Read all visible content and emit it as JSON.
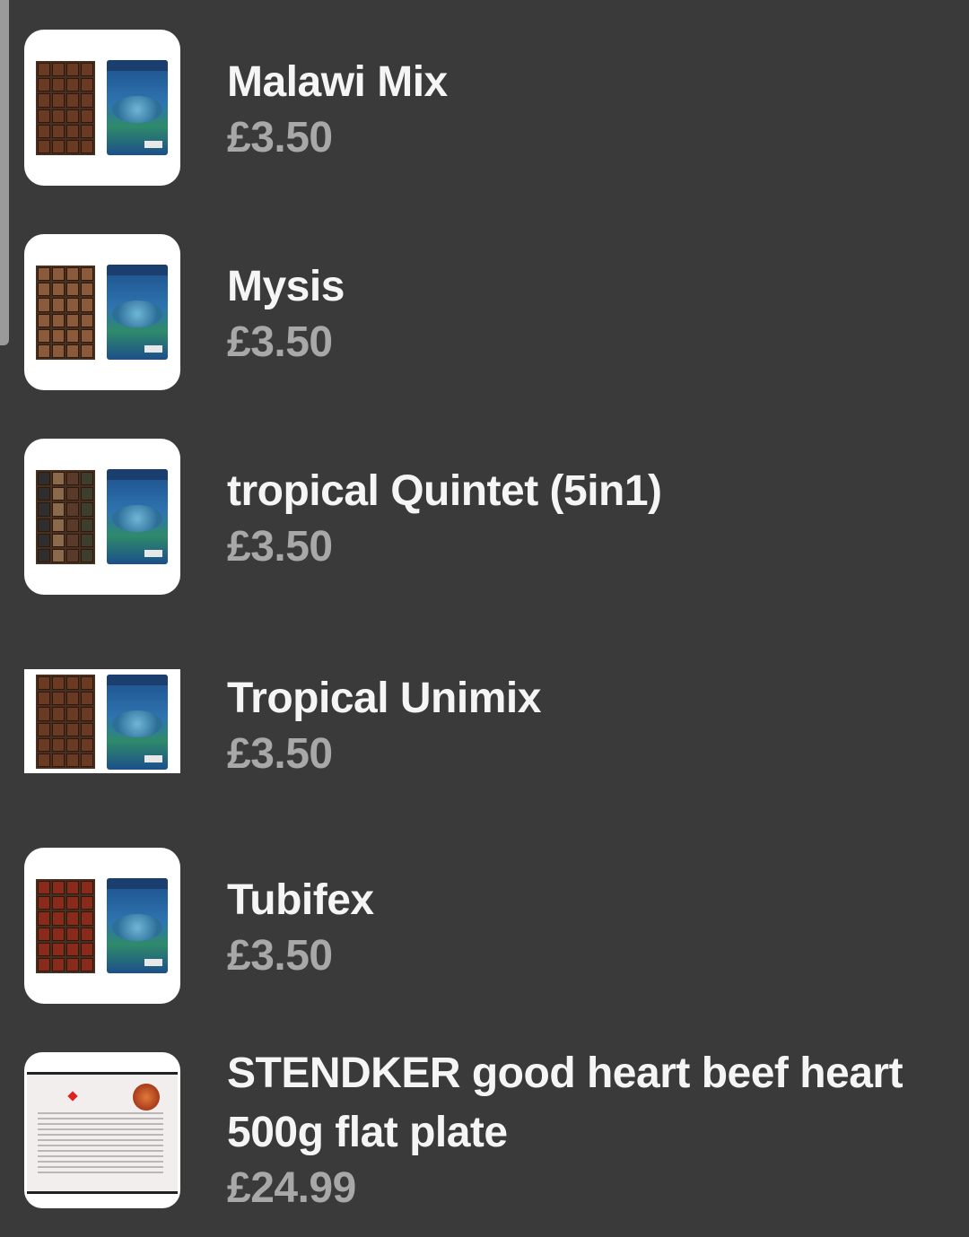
{
  "products": [
    {
      "name": "Malawi Mix",
      "price": "£3.50",
      "image_icon": "malawi-mix-pack-image"
    },
    {
      "name": "Mysis",
      "price": "£3.50",
      "image_icon": "mysis-pack-image"
    },
    {
      "name": "tropical Quintet (5in1)",
      "price": "£3.50",
      "image_icon": "tropical-quintet-pack-image"
    },
    {
      "name": "Tropical Unimix",
      "price": "£3.50",
      "image_icon": "tropical-unimix-pack-image"
    },
    {
      "name": "Tubifex",
      "price": "£3.50",
      "image_icon": "tubifex-pack-image"
    },
    {
      "name": "STENDKER good heart beef heart 500g flat plate",
      "price": "£24.99",
      "image_icon": "stendker-beef-heart-pack-image"
    }
  ],
  "colors": {
    "background": "#3a3a3a",
    "name_text": "#f5f5f5",
    "price_text": "#a8a8a8"
  }
}
